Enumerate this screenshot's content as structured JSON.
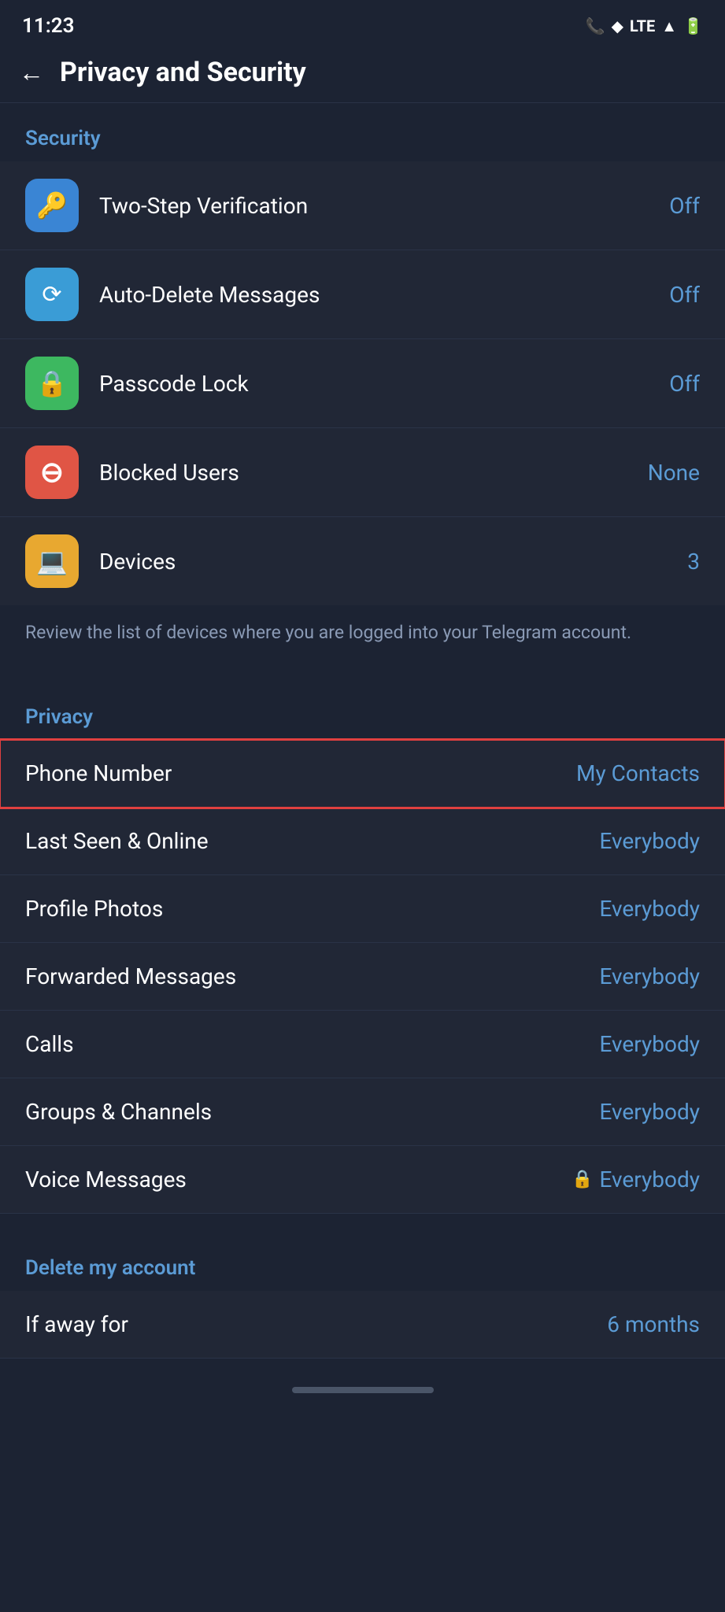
{
  "statusBar": {
    "time": "11:23",
    "icons": [
      "📞",
      "◆",
      "LTE",
      "▲",
      "🔋"
    ]
  },
  "toolbar": {
    "backLabel": "←",
    "title": "Privacy and Security"
  },
  "security": {
    "sectionLabel": "Security",
    "items": [
      {
        "id": "two-step",
        "label": "Two-Step Verification",
        "value": "Off",
        "iconColor": "icon-blue",
        "iconSymbol": "🔑"
      },
      {
        "id": "auto-delete",
        "label": "Auto-Delete Messages",
        "value": "Off",
        "iconColor": "icon-teal",
        "iconSymbol": "⟳"
      },
      {
        "id": "passcode",
        "label": "Passcode Lock",
        "value": "Off",
        "iconColor": "icon-green",
        "iconSymbol": "🔒"
      },
      {
        "id": "blocked-users",
        "label": "Blocked Users",
        "value": "None",
        "iconColor": "icon-red",
        "iconSymbol": "⊖"
      },
      {
        "id": "devices",
        "label": "Devices",
        "value": "3",
        "iconColor": "icon-yellow",
        "iconSymbol": "💻"
      }
    ],
    "devicesDescription": "Review the list of devices where you are logged into your Telegram account."
  },
  "privacy": {
    "sectionLabel": "Privacy",
    "items": [
      {
        "id": "phone-number",
        "label": "Phone Number",
        "value": "My Contacts",
        "highlighted": true,
        "lockIcon": false
      },
      {
        "id": "last-seen",
        "label": "Last Seen & Online",
        "value": "Everybody",
        "highlighted": false,
        "lockIcon": false
      },
      {
        "id": "profile-photos",
        "label": "Profile Photos",
        "value": "Everybody",
        "highlighted": false,
        "lockIcon": false
      },
      {
        "id": "forwarded-messages",
        "label": "Forwarded Messages",
        "value": "Everybody",
        "highlighted": false,
        "lockIcon": false
      },
      {
        "id": "calls",
        "label": "Calls",
        "value": "Everybody",
        "highlighted": false,
        "lockIcon": false
      },
      {
        "id": "groups-channels",
        "label": "Groups & Channels",
        "value": "Everybody",
        "highlighted": false,
        "lockIcon": false
      },
      {
        "id": "voice-messages",
        "label": "Voice Messages",
        "value": "Everybody",
        "highlighted": false,
        "lockIcon": true
      }
    ]
  },
  "deleteAccount": {
    "sectionLabel": "Delete my account",
    "items": [
      {
        "id": "if-away",
        "label": "If away for",
        "value": "6 months"
      }
    ]
  },
  "bottomBar": {
    "pillLabel": ""
  }
}
